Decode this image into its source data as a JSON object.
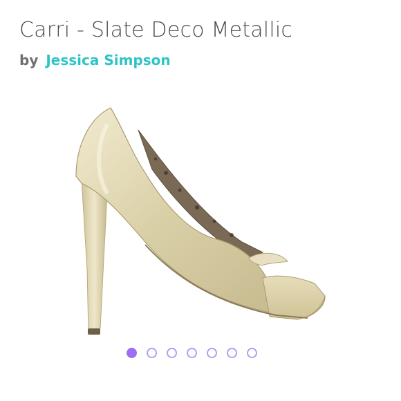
{
  "product": {
    "title": "Carri - Slate Deco Metallic",
    "by_label": "by",
    "brand": "Jessica Simpson"
  },
  "carousel": {
    "dot_count": 7,
    "active_index": 0,
    "active_color": "#9b6ef3",
    "inactive_color": "#b49cf3"
  },
  "colors": {
    "title": "#4a4a4a",
    "byline": "#6f6f6f",
    "brand": "#2ec4c6"
  }
}
